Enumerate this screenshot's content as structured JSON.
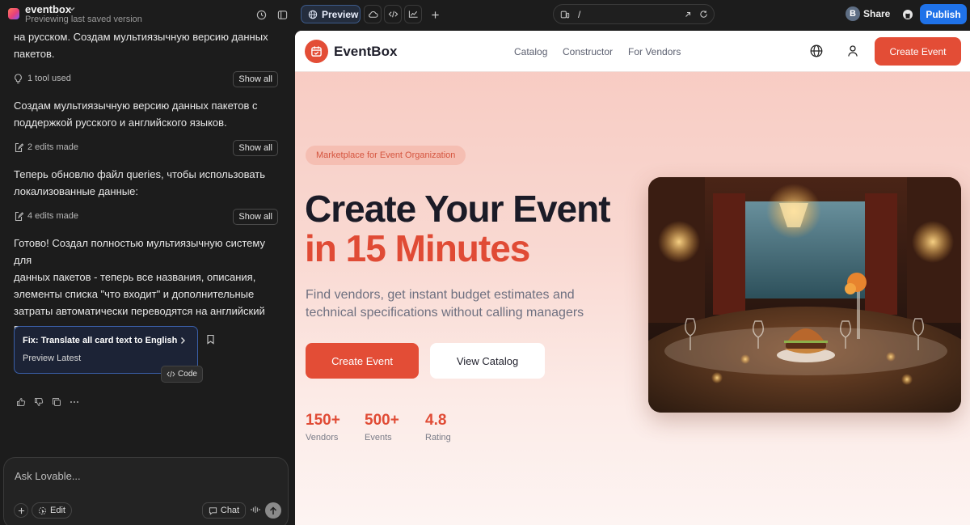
{
  "topbar": {
    "project_name": "eventbox",
    "project_status": "Previewing last saved version",
    "preview_label": "Preview",
    "url_path": "/",
    "avatar_initial": "B",
    "share_label": "Share",
    "publish_label": "Publish"
  },
  "chat": {
    "messages": {
      "m1": [
        "на русском. Создам мультиязычную версию данных",
        "пакетов."
      ],
      "m2": [
        "Создам мультиязычную версию данных пакетов с",
        "поддержкой русского и английского языков."
      ],
      "m3": [
        "Теперь обновлю файл queries, чтобы использовать",
        "локализованные данные:"
      ],
      "m4": [
        "Готово! Создал полностью мультиязычную систему для",
        "данных пакетов - теперь все названия, описания,",
        "элементы списка \"что входит\" и дополнительные",
        "затраты автоматически переводятся на английский при",
        "переключении языка."
      ]
    },
    "tool_rows": [
      {
        "label": "1 tool used",
        "action": "Show all"
      },
      {
        "label": "2 edits made",
        "action": "Show all"
      },
      {
        "label": "4 edits made",
        "action": "Show all"
      }
    ],
    "fix_card": {
      "title": "Fix: Translate all card text to English",
      "subtitle": "Preview Latest"
    },
    "code_tooltip": "Code",
    "composer": {
      "placeholder": "Ask Lovable...",
      "edit_label": "Edit",
      "chat_label": "Chat"
    }
  },
  "site": {
    "brand": "EventBox",
    "nav": {
      "catalog": "Catalog",
      "constructor": "Constructor",
      "vendors": "For Vendors",
      "cta": "Create Event"
    },
    "hero": {
      "badge": "Marketplace for Event Organization",
      "title_line1": "Create Your Event",
      "title_line2": "in 15 Minutes",
      "subtitle_line1": "Find vendors, get instant budget estimates and",
      "subtitle_line2": "technical specifications without calling managers",
      "primary_cta": "Create Event",
      "secondary_cta": "View Catalog"
    },
    "stats": [
      {
        "value": "150+",
        "label": "Vendors"
      },
      {
        "value": "500+",
        "label": "Events"
      },
      {
        "value": "4.8",
        "label": "Rating"
      }
    ]
  },
  "colors": {
    "accent": "#e34d36",
    "publish": "#1f72e8",
    "editor_bg": "#1c1c1c"
  }
}
